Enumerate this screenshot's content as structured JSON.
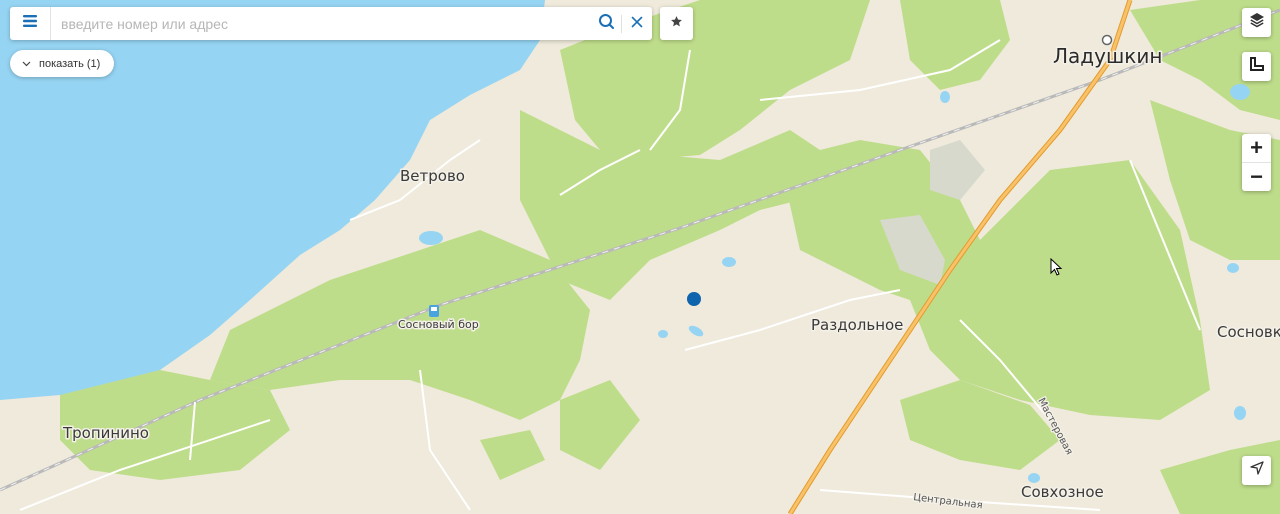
{
  "search": {
    "placeholder": "введите номер или адрес"
  },
  "filter": {
    "show_label": "показать (1)"
  },
  "map": {
    "places": {
      "ladushkin": "Ладушкин",
      "vetrovo": "Ветрово",
      "sosnovy_bor": "Сосновый бор",
      "tropinino": "Тропинино",
      "razdolnoe": "Раздольное",
      "sosnovka": "Сосновк",
      "sovkhoznoe": "Совхозное"
    },
    "roads": {
      "masterovaya": "Мастеровая",
      "tsentralnaya": "Центральная"
    },
    "colors": {
      "water": "#96d4f3",
      "forest": "#bedd8a",
      "land": "#efeadb",
      "highway": "#f2a93b",
      "marker": "#0e64ad"
    }
  },
  "icons": {
    "menu": "hamburger-icon",
    "search": "search-icon",
    "clear": "close-icon",
    "favorite": "star-icon",
    "layers": "layers-icon",
    "ruler": "ruler-icon",
    "locate": "navigation-arrow-icon"
  },
  "zoom": {
    "in_label": "+",
    "out_label": "−"
  }
}
